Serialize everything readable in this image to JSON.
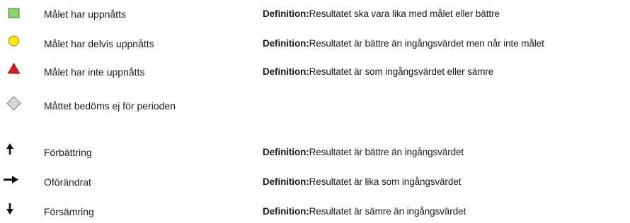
{
  "colors": {
    "achieved": "#8cd16b",
    "partial": "#ffee00",
    "not_achieved": "#e11a1a",
    "not_assessed": "#d6d6d6",
    "arrow": "#111111"
  },
  "status_items": [
    {
      "icon": "green-square-icon",
      "label": "Målet har uppnåtts",
      "definition_label": "Definition:",
      "definition": "Resultatet ska vara lika med målet eller bättre"
    },
    {
      "icon": "yellow-circle-icon",
      "label": "Målet har delvis uppnåtts",
      "definition_label": "Definition:",
      "definition": "Resultatet är bättre än  ingångsvärdet men når inte målet"
    },
    {
      "icon": "red-triangle-icon",
      "label": "Målet har inte uppnåtts",
      "definition_label": "Definition:",
      "definition": "Resultatet är som  ingångsvärdet eller sämre"
    },
    {
      "icon": "gray-diamond-icon",
      "label": "Måttet bedöms ej för perioden"
    }
  ],
  "trend_items": [
    {
      "icon": "arrow-up-icon",
      "label": "Förbättring",
      "definition_label": "Definition:",
      "definition": "Resultatet är bättre än ingångsvärdet"
    },
    {
      "icon": "arrow-right-icon",
      "label": "Oförändrat",
      "definition_label": "Definition:",
      "definition": "Resultatet är lika som ingångsvärdet"
    },
    {
      "icon": "arrow-down-icon",
      "label": "Försämring",
      "definition_label": "Definition:",
      "definition": "Resultatet är sämre än ingångsvärdet"
    }
  ]
}
